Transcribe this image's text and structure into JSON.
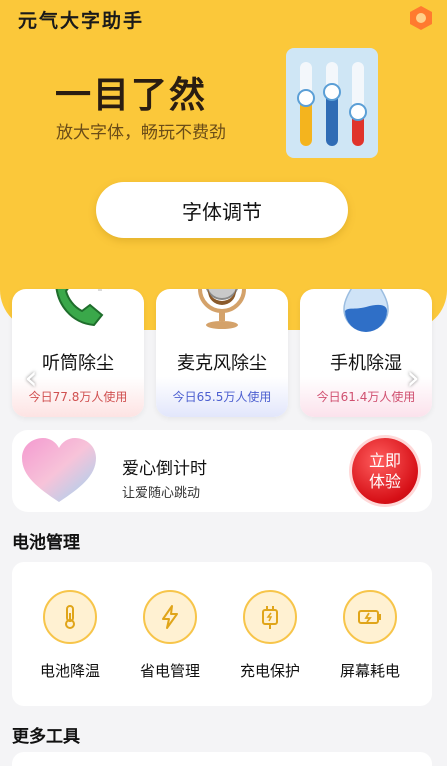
{
  "header": {
    "app_title": "元气大字助手",
    "settings_icon": "hexagon-settings-icon"
  },
  "hero": {
    "headline": "一目了然",
    "subline": "放大字体，畅玩不费劲",
    "illustration_icon": "sliders-illustration",
    "font_button_label": "字体调节",
    "accent_color": "#fbc83a"
  },
  "tools": [
    {
      "name": "听筒除尘",
      "usage": "今日77.8万人使用",
      "icon": "phone-icon"
    },
    {
      "name": "麦克风除尘",
      "usage": "今日65.5万人使用",
      "icon": "microphone-icon"
    },
    {
      "name": "手机除湿",
      "usage": "今日61.4万人使用",
      "icon": "water-drop-icon"
    }
  ],
  "carousel": {
    "prev_icon": "chevron-left-icon",
    "next_icon": "chevron-right-icon"
  },
  "love": {
    "title": "爱心倒计时",
    "subtitle": "让爱随心跳动",
    "button_line1": "立即",
    "button_line2": "体验",
    "icon": "heart-icon"
  },
  "battery": {
    "title": "电池管理",
    "items": [
      {
        "label": "电池降温",
        "icon": "thermometer-icon"
      },
      {
        "label": "省电管理",
        "icon": "lightning-icon"
      },
      {
        "label": "充电保护",
        "icon": "charger-plug-icon"
      },
      {
        "label": "屏幕耗电",
        "icon": "battery-charging-icon"
      }
    ],
    "icon_color": "#e0a51a"
  },
  "more": {
    "title": "更多工具"
  }
}
